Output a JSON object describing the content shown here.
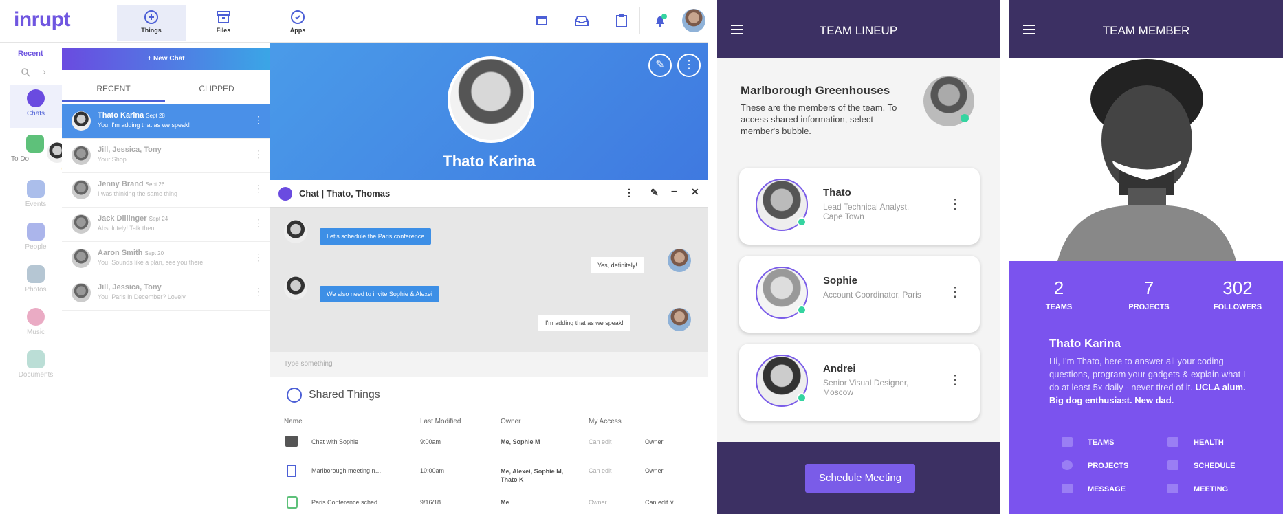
{
  "app": {
    "logo": "inrupt",
    "nav": [
      {
        "label": "Things"
      },
      {
        "label": "Files"
      },
      {
        "label": "Apps"
      }
    ],
    "rail_title": "Recent",
    "rail": [
      {
        "label": "Chats"
      },
      {
        "label": "To Do"
      },
      {
        "label": "Events"
      },
      {
        "label": "People"
      },
      {
        "label": "Photos"
      },
      {
        "label": "Music"
      },
      {
        "label": "Documents"
      }
    ],
    "new_chat": "+ New Chat",
    "tabs": [
      "RECENT",
      "CLIPPED"
    ],
    "chats": [
      {
        "name": "Thato Karina",
        "date": "Sept 28",
        "msg": "You: I'm adding that as we speak!"
      },
      {
        "name": "Jill, Jessica, Tony",
        "date": "",
        "msg": "Your Shop"
      },
      {
        "name": "Jenny Brand",
        "date": "Sept 26",
        "msg": "I was thinking the same thing"
      },
      {
        "name": "Jack Dillinger",
        "date": "Sept 24",
        "msg": "Absolutely! Talk then"
      },
      {
        "name": "Aaron Smith",
        "date": "Sept 20",
        "msg": "You: Sounds like a plan, see you there"
      },
      {
        "name": "Jill, Jessica, Tony",
        "date": "",
        "msg": "You: Paris in December? Lovely"
      }
    ],
    "profile_name": "Thato Karina",
    "chat_title": "Chat | Thato, Thomas",
    "messages": [
      {
        "text": "Let's schedule the Paris conference",
        "dir": "in"
      },
      {
        "text": "Yes, definitely!",
        "dir": "out"
      },
      {
        "text": "We also need to invite Sophie & Alexei",
        "dir": "in"
      },
      {
        "text": "I'm adding that as we speak!",
        "dir": "out"
      }
    ],
    "input_placeholder": "Type something",
    "shared_title": "Shared Things",
    "columns": [
      "Name",
      "Last Modified",
      "Owner",
      "My Access"
    ],
    "rows": [
      {
        "name": "Chat with Sophie",
        "modified": "9:00am",
        "owner": "Me, Sophie M",
        "access": "Can edit",
        "role": "Owner"
      },
      {
        "name": "Marlborough meeting n…",
        "modified": "10:00am",
        "owner": "Me, Alexei, Sophie M, Thato K",
        "access": "Can edit",
        "role": "Owner"
      },
      {
        "name": "Paris Conference sched…",
        "modified": "9/16/18",
        "owner": "Me",
        "access": "Owner",
        "role": "Can edit ∨"
      }
    ]
  },
  "lineup": {
    "title": "TEAM LINEUP",
    "org": "Marlborough Greenhouses",
    "desc": "These are the members of the team. To access shared information, select member's bubble.",
    "members": [
      {
        "name": "Thato",
        "role": "Lead Technical Analyst, Cape Town"
      },
      {
        "name": "Sophie",
        "role": "Account Coordinator, Paris"
      },
      {
        "name": "Andrei",
        "role": "Senior Visual Designer, Moscow"
      }
    ],
    "button": "Schedule Meeting"
  },
  "member": {
    "title": "TEAM MEMBER",
    "stats": [
      {
        "num": "2",
        "label": "TEAMS"
      },
      {
        "num": "7",
        "label": "PROJECTS"
      },
      {
        "num": "302",
        "label": "FOLLOWERS"
      }
    ],
    "name": "Thato Karina",
    "bio": "Hi, I'm Thato, here to answer all your coding questions, program your gadgets & explain what I do at least 5x daily - never tired of it.",
    "bio_bold": "UCLA alum. Big dog enthusiast. New dad.",
    "links": [
      "TEAMS",
      "HEALTH",
      "PROJECTS",
      "SCHEDULE",
      "MESSAGE",
      "MEETING"
    ]
  },
  "colors": {
    "accent": "#6f56e0",
    "blue": "#4a90e8",
    "dark": "#3c3063",
    "purple": "#7b53ee",
    "online": "#35d4a0"
  }
}
